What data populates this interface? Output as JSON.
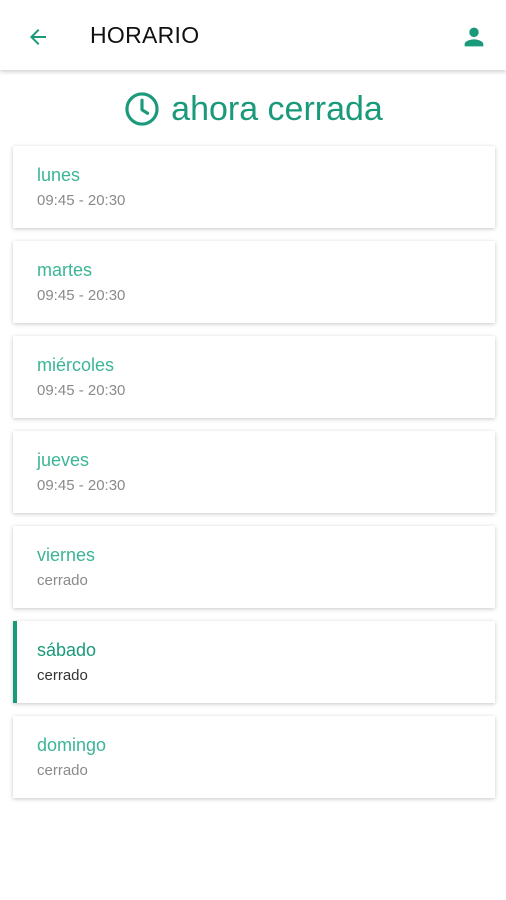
{
  "header": {
    "title": "HORARIO",
    "back_icon": "arrow-left-icon",
    "profile_icon": "person-icon"
  },
  "status": {
    "icon": "clock-icon",
    "text": "ahora cerrada"
  },
  "colors": {
    "accent": "#1a9a7a",
    "day_name": "#3bb596",
    "hours_text": "#8a8a8a"
  },
  "days": [
    {
      "name": "lunes",
      "hours": "09:45 - 20:30",
      "active": false
    },
    {
      "name": "martes",
      "hours": "09:45 - 20:30",
      "active": false
    },
    {
      "name": "miércoles",
      "hours": "09:45 - 20:30",
      "active": false
    },
    {
      "name": "jueves",
      "hours": "09:45 - 20:30",
      "active": false
    },
    {
      "name": "viernes",
      "hours": "cerrado",
      "active": false
    },
    {
      "name": "sábado",
      "hours": "cerrado",
      "active": true
    },
    {
      "name": "domingo",
      "hours": "cerrado",
      "active": false
    }
  ]
}
